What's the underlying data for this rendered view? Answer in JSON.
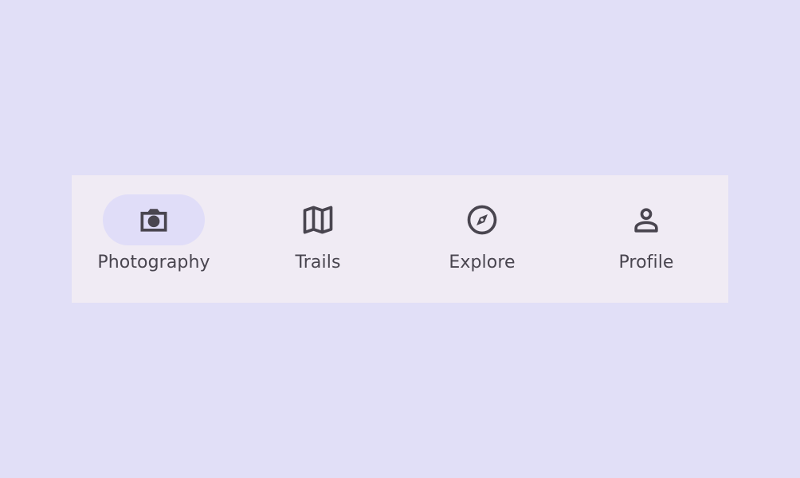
{
  "nav": {
    "active_index": 0,
    "items": [
      {
        "label": "Photography",
        "icon": "camera-icon"
      },
      {
        "label": "Trails",
        "icon": "map-icon"
      },
      {
        "label": "Explore",
        "icon": "compass-icon"
      },
      {
        "label": "Profile",
        "icon": "person-icon"
      }
    ]
  },
  "colors": {
    "page_background": "#e1dff7",
    "bar_background": "#f0ebf4",
    "active_indicator": "#e0ddf8",
    "icon": "#49454f",
    "label": "#49454f"
  }
}
